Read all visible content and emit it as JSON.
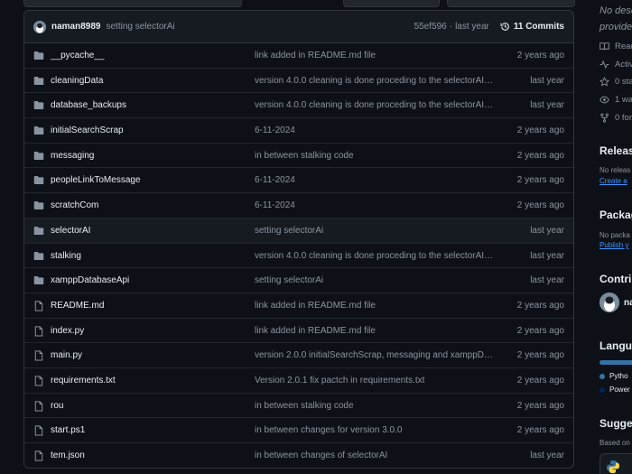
{
  "colors": {
    "bg": "#0d1117",
    "header_bg": "#161b22",
    "border": "#30363d",
    "muted": "#8b949e",
    "link": "#4493f8",
    "python": "#3572A5",
    "powershell": "#012456"
  },
  "commit": {
    "author": "naman8989",
    "message": "setting selectorAi",
    "hash": "55ef596",
    "time": "last year",
    "commits_label": "11 Commits"
  },
  "files": [
    {
      "type": "folder",
      "name": "__pycache__",
      "message": "link added in README.md file",
      "time": "2 years ago"
    },
    {
      "type": "folder",
      "name": "cleaningData",
      "message": "version 4.0.0 cleaning is done proceding to the selectorAI ...",
      "time": "last year"
    },
    {
      "type": "folder",
      "name": "database_backups",
      "message": "version 4.0.0 cleaning is done proceding to the selectorAI ...",
      "time": "last year"
    },
    {
      "type": "folder",
      "name": "initialSearchScrap",
      "message": "6-11-2024",
      "time": "2 years ago"
    },
    {
      "type": "folder",
      "name": "messaging",
      "message": "in between stalking code",
      "time": "2 years ago"
    },
    {
      "type": "folder",
      "name": "peopleLinkToMessage",
      "message": "6-11-2024",
      "time": "2 years ago"
    },
    {
      "type": "folder",
      "name": "scratchCom",
      "message": "6-11-2024",
      "time": "2 years ago"
    },
    {
      "type": "folder",
      "name": "selectorAI",
      "message": "setting selectorAi",
      "time": "last year"
    },
    {
      "type": "folder",
      "name": "stalking",
      "message": "version 4.0.0 cleaning is done proceding to the selectorAI ...",
      "time": "last year"
    },
    {
      "type": "folder",
      "name": "xamppDatabaseApi",
      "message": "setting selectorAi",
      "time": "last year"
    },
    {
      "type": "file",
      "name": "README.md",
      "message": "link added in README.md file",
      "time": "2 years ago"
    },
    {
      "type": "file",
      "name": "index.py",
      "message": "link added in README.md file",
      "time": "2 years ago"
    },
    {
      "type": "file",
      "name": "main.py",
      "message": "version 2.0.0 initialSearchScrap, messaging and xamppDa...",
      "time": "2 years ago"
    },
    {
      "type": "file",
      "name": "requirements.txt",
      "message": "Version 2.0.1 fix pactch in requirements.txt",
      "time": "2 years ago"
    },
    {
      "type": "file",
      "name": "rou",
      "message": "in between stalking code",
      "time": "2 years ago"
    },
    {
      "type": "file",
      "name": "start.ps1",
      "message": "in between changes for version 3.0.0",
      "time": "2 years ago"
    },
    {
      "type": "file",
      "name": "tem.json",
      "message": "in between changes of selectorAI",
      "time": "last year"
    }
  ],
  "sidebar": {
    "desc_line1": "No desc",
    "desc_line2": "provide",
    "items": [
      {
        "icon": "book-icon",
        "label": "Read"
      },
      {
        "icon": "pulse-icon",
        "label": "Activ"
      },
      {
        "icon": "star-icon",
        "label": "0 sta"
      },
      {
        "icon": "eye-icon",
        "label": "1 wa"
      },
      {
        "icon": "fork-icon",
        "label": "0 for"
      }
    ],
    "releases_title": "Releas",
    "releases_note": "No releas",
    "releases_link": "Create a",
    "packages_title": "Packag",
    "packages_note": "No packa",
    "packages_link": "Publish y",
    "contrib_title": "Contrib",
    "contrib_name": "na",
    "languages_title": "Langua",
    "languages": [
      {
        "name": "Pytho",
        "color": "#3572A5"
      },
      {
        "name": "Power",
        "color": "#012456"
      }
    ],
    "suggested_title": "Sugges",
    "suggested_note": "Based on"
  }
}
